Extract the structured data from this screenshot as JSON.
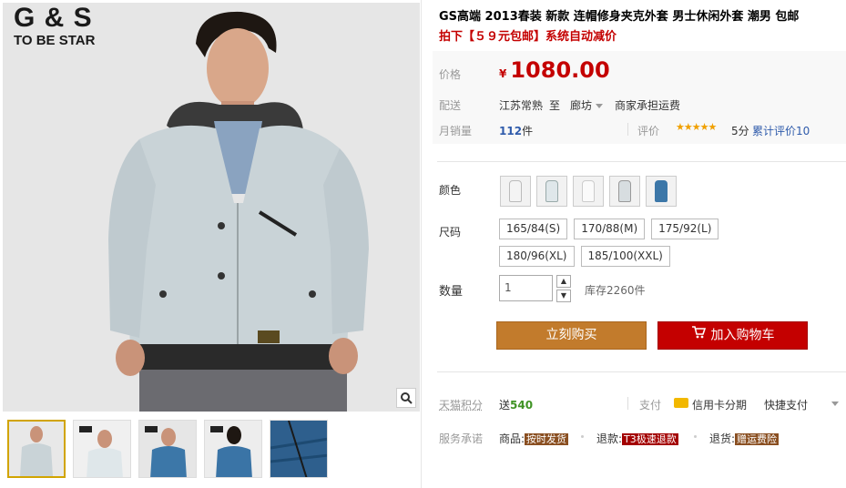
{
  "gallery": {
    "brand_big": "G & S",
    "brand_small": "TO BE STAR",
    "zoom_icon": "magnifier-icon",
    "thumb_count": 5
  },
  "product": {
    "title": "GS高端 2013春装 新款 连帽修身夹克外套 男士休闲外套 潮男 包邮",
    "promo": "拍下【５９元包邮】系统自动减价"
  },
  "price": {
    "label": "价格",
    "currency": "¥",
    "value": "1080.00"
  },
  "shipping": {
    "label": "配送",
    "from": "江苏常熟",
    "to_word": "至",
    "destination": "廊坊",
    "fee_text": "商家承担运费"
  },
  "sales": {
    "label": "月销量",
    "count": "112",
    "unit": "件",
    "rating_label": "评价",
    "stars": "★★★★★",
    "score": "5分",
    "review_link": "累计评价10"
  },
  "color": {
    "label": "颜色",
    "swatches": [
      "#f4f4f4",
      "#dfe7ea",
      "#fafafa",
      "#d7dde0",
      "#3c77a8"
    ]
  },
  "size": {
    "label": "尺码",
    "options": [
      "165/84(S)",
      "170/88(M)",
      "175/92(L)",
      "180/96(XL)",
      "185/100(XXL)"
    ]
  },
  "quantity": {
    "label": "数量",
    "value": "1",
    "up": "▲",
    "down": "▼",
    "stock": "库存2260件"
  },
  "actions": {
    "buy_now": "立刻购买",
    "add_cart": "加入购物车"
  },
  "points": {
    "label": "天猫积分",
    "prefix": "送",
    "value": "540",
    "pay_label": "支付",
    "card_text": "信用卡分期",
    "quick_pay": "快捷支付"
  },
  "promise": {
    "label": "服务承诺",
    "items": [
      {
        "prefix": "商品:",
        "tag": "按时发货"
      },
      {
        "prefix": "退款:",
        "tag": "T3极速退款"
      },
      {
        "prefix": "退货:",
        "tag": "赠运费险"
      }
    ]
  },
  "colors": {
    "accent_red": "#c40000",
    "buy_orange": "#c27b2c",
    "link_blue": "#2f5bab"
  }
}
